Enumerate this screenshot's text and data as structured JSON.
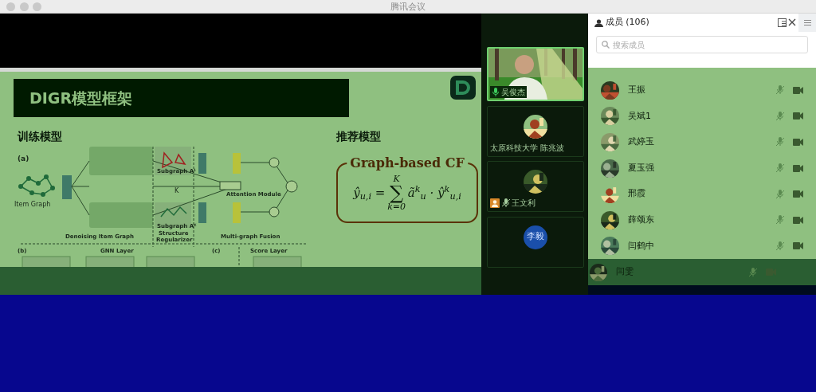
{
  "window": {
    "title": "腾讯会议"
  },
  "slide": {
    "title": "DIGR模型框架",
    "left_heading": "训练模型",
    "right_heading": "推荐模型",
    "diagram_labels": [
      "(a)",
      "Item Graph",
      "Subgraph A¹",
      "K",
      "Subgraph Aᴷ",
      "Denoising Item Graph",
      "Structure",
      "Regularizer",
      "Attention Module",
      "Multi-graph Fusion",
      "(b)",
      "GNN Layer",
      "(c)",
      "Score Layer"
    ],
    "formula": {
      "title": "Graph-based CF",
      "lhs": "ŷ$_{u,i}$ =",
      "sum": "∑",
      "upper": "K",
      "lower": "k=0",
      "rhs": "ã$^{k}$$_{u}$ · ŷ$^{k}$$_{u,i}$"
    }
  },
  "videos": [
    {
      "kind": "video",
      "name": "吴俊杰",
      "muted": false
    },
    {
      "kind": "avatar",
      "name": "太原科技大学 陈兆波"
    },
    {
      "kind": "avatar",
      "name": "王文利",
      "muted": true,
      "host": true
    },
    {
      "kind": "initials",
      "initials": "李毅"
    }
  ],
  "members": {
    "title": "成员 (106)",
    "search_placeholder": "搜索成员",
    "items": [
      {
        "name": "王振"
      },
      {
        "name": "吴斌1"
      },
      {
        "name": "武婷玉"
      },
      {
        "name": "夏玉强"
      },
      {
        "name": "邢霞"
      },
      {
        "name": "薛颂东"
      },
      {
        "name": "闫鹤中"
      },
      {
        "name": "闫雯"
      }
    ]
  }
}
